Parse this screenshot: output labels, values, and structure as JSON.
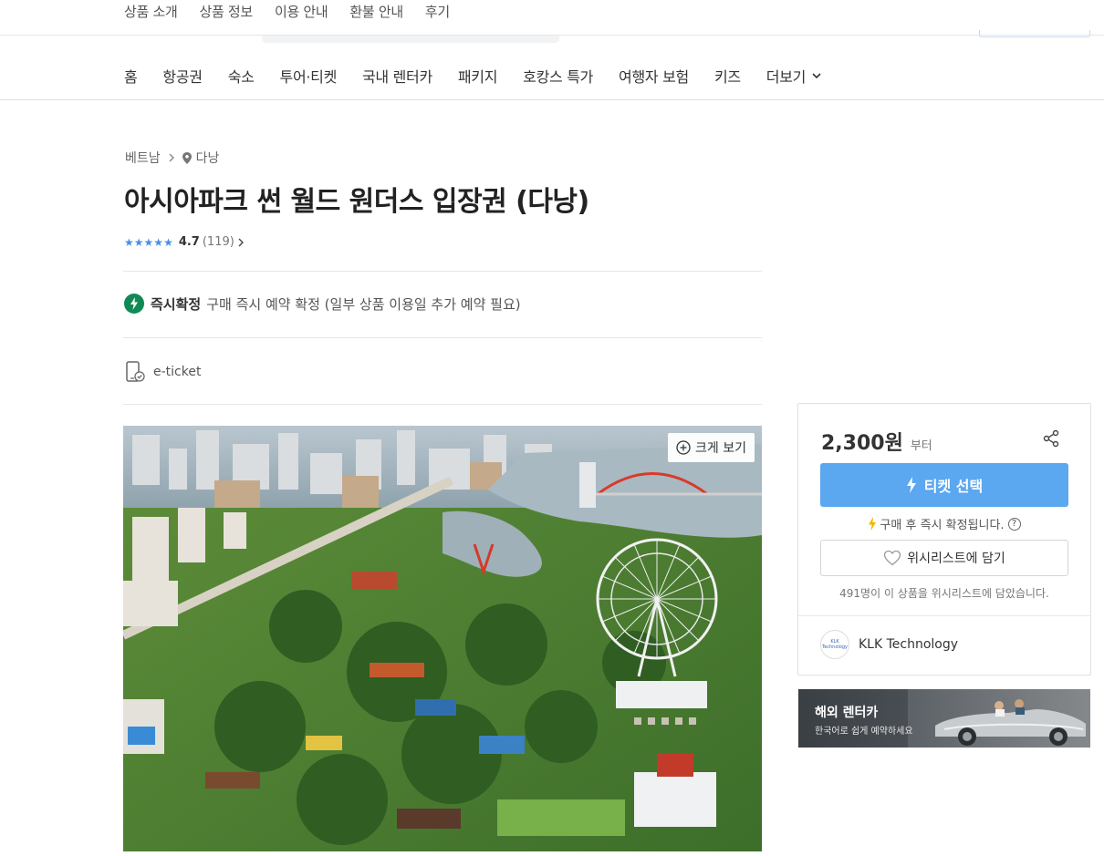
{
  "top_tabs": [
    "상품 소개",
    "상품 정보",
    "이용 안내",
    "환불 안내",
    "후기"
  ],
  "main_nav": [
    "홈",
    "항공권",
    "숙소",
    "투어·티켓",
    "국내 렌터카",
    "패키지",
    "호캉스 특가",
    "여행자 보험",
    "키즈",
    "더보기"
  ],
  "breadcrumb": {
    "country": "베트남",
    "city": "다낭"
  },
  "product": {
    "title": "아시아파크 썬 월드 원더스 입장권 (다낭)",
    "rating": "4.7",
    "review_count": "(119)",
    "confirm_label": "즉시확정",
    "confirm_text": "구매 즉시 예약 확정 (일부 상품 이용일 추가 예약 필요)",
    "ticket_type": "e-ticket",
    "zoom_label": "크게 보기"
  },
  "price_card": {
    "price": "2,300원",
    "price_suffix": "부터",
    "select_button": "티켓 선택",
    "instant_note": "구매 후 즉시 확정됩니다.",
    "help": "?",
    "wishlist_button": "위시리스트에 담기",
    "wishlist_count": "491명이 이 상품을 위시리스트에 담았습니다.",
    "vendor": "KLK Technology",
    "vendor_logo": "KLK Technology"
  },
  "banner": {
    "title": "해외 렌터카",
    "subtitle": "한국어로 쉽게 예약하세요"
  },
  "colors": {
    "primary": "#5ba7f0",
    "confirm_green": "#0f8a55",
    "star_blue": "#4a90e2"
  }
}
